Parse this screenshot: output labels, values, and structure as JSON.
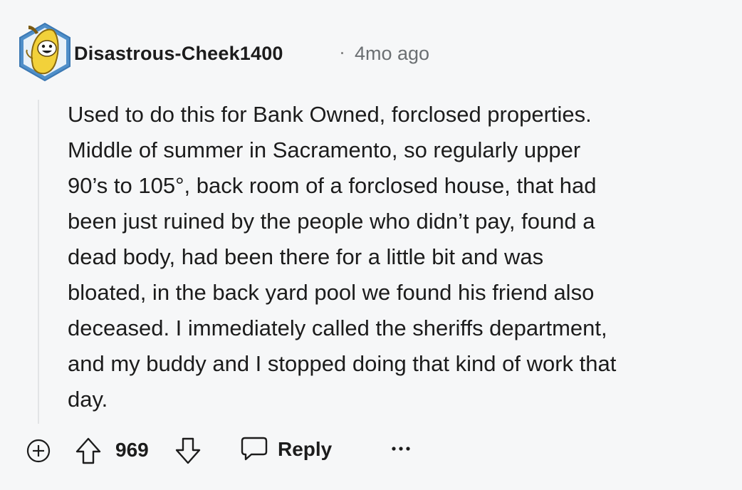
{
  "comment": {
    "author": "Disastrous-Cheek1400",
    "separator": "·",
    "time_ago": "4mo ago",
    "body": "Used to do this for Bank Owned, forclosed properties.\nMiddle of summer in Sacramento, so regularly upper\n90’s to 105°, back room of a forclosed house, that had\nbeen just ruined by the people who didn’t pay, found a\ndead body, had been there for a little bit and was\nbloated, in the back yard pool we found his friend also\ndeceased. I immediately called the sheriffs department,\nand my buddy and I stopped doing that kind of work that\nday."
  },
  "actions": {
    "score": "969",
    "reply_label": "Reply"
  },
  "icons": {
    "expand": "plus-circle-icon",
    "upvote": "arrow-up-icon",
    "downvote": "arrow-down-icon",
    "reply": "speech-bubble-icon",
    "more": "ellipsis-icon",
    "avatar": "banana-snoo-avatar"
  },
  "colors": {
    "background": "#f6f7f8",
    "text": "#1c1c1c",
    "muted": "#6b6f72",
    "avatar_hex": "#5b9bd1"
  }
}
